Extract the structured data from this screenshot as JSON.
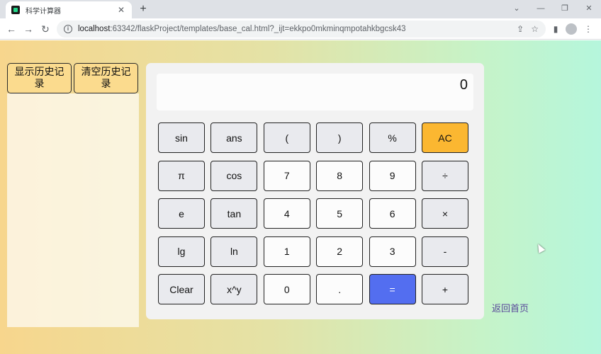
{
  "browser": {
    "tab_title": "科学计算器",
    "tab_close": "✕",
    "new_tab": "+",
    "url_host": "localhost",
    "url_rest": ":63342/flaskProject/templates/base_cal.html?_ijt=ekkpo0mkminqmpotahkbgcsk43",
    "controls": {
      "minimize": "—",
      "restore": "❐",
      "close": "✕",
      "tabs_menu": "⌄"
    },
    "nav": {
      "back": "←",
      "forward": "→",
      "reload": "↻"
    }
  },
  "history": {
    "show_label": "显示历史记录",
    "clear_label": "清空历史记录"
  },
  "calculator": {
    "display_value": "0",
    "rows": [
      [
        {
          "label": "sin",
          "name": "sin"
        },
        {
          "label": "ans",
          "name": "ans"
        },
        {
          "label": "(",
          "name": "open-paren"
        },
        {
          "label": ")",
          "name": "close-paren"
        },
        {
          "label": "%",
          "name": "percent"
        },
        {
          "label": "AC",
          "name": "all-clear",
          "style": "ac"
        }
      ],
      [
        {
          "label": "π",
          "name": "pi"
        },
        {
          "label": "cos",
          "name": "cos"
        },
        {
          "label": "7",
          "name": "digit-7",
          "style": "num"
        },
        {
          "label": "8",
          "name": "digit-8",
          "style": "num"
        },
        {
          "label": "9",
          "name": "digit-9",
          "style": "num"
        },
        {
          "label": "÷",
          "name": "divide"
        }
      ],
      [
        {
          "label": "e",
          "name": "euler"
        },
        {
          "label": "tan",
          "name": "tan"
        },
        {
          "label": "4",
          "name": "digit-4",
          "style": "num"
        },
        {
          "label": "5",
          "name": "digit-5",
          "style": "num"
        },
        {
          "label": "6",
          "name": "digit-6",
          "style": "num"
        },
        {
          "label": "×",
          "name": "multiply"
        }
      ],
      [
        {
          "label": "lg",
          "name": "log10"
        },
        {
          "label": "ln",
          "name": "ln"
        },
        {
          "label": "1",
          "name": "digit-1",
          "style": "num"
        },
        {
          "label": "2",
          "name": "digit-2",
          "style": "num"
        },
        {
          "label": "3",
          "name": "digit-3",
          "style": "num"
        },
        {
          "label": "-",
          "name": "subtract"
        }
      ],
      [
        {
          "label": "Clear",
          "name": "clear"
        },
        {
          "label": "x^y",
          "name": "power"
        },
        {
          "label": "0",
          "name": "digit-0",
          "style": "num"
        },
        {
          "label": ".",
          "name": "decimal",
          "style": "num"
        },
        {
          "label": "=",
          "name": "equals",
          "style": "eq"
        },
        {
          "label": "+",
          "name": "add"
        }
      ]
    ]
  },
  "home_link": "返回首页",
  "colors": {
    "ac": "#fbb731",
    "equals": "#536ef0",
    "history_button": "#fbdb8e"
  }
}
